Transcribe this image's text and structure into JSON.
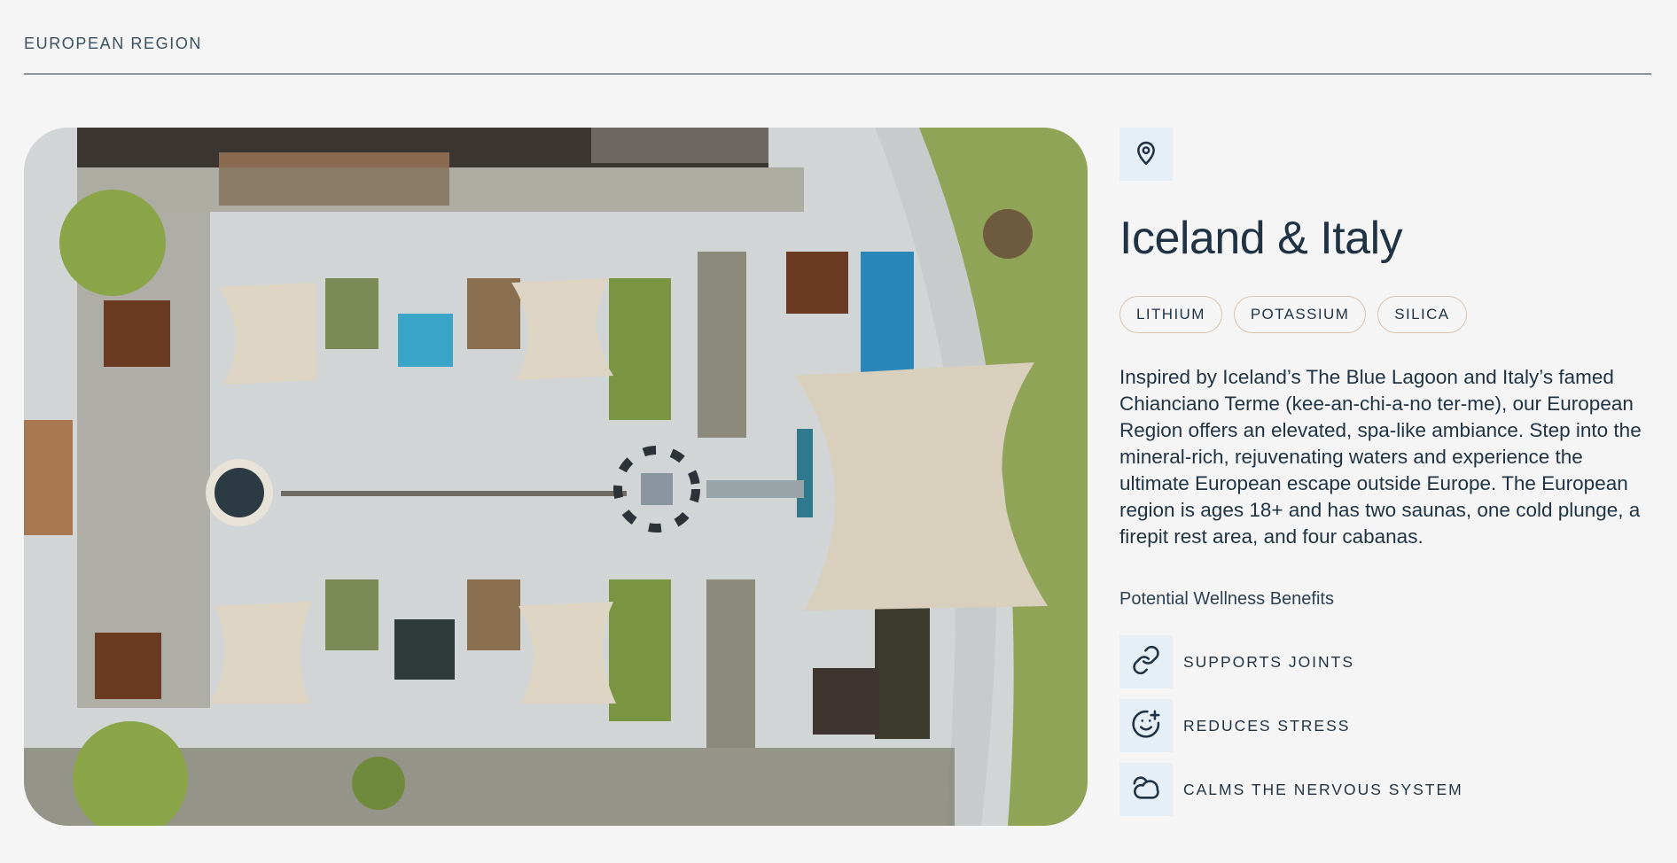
{
  "section": {
    "title": "EUROPEAN REGION"
  },
  "photo": {
    "alt": "Aerial view of the European region spa courtyard"
  },
  "location": {
    "icon": "map-pin-icon",
    "title": "Iceland & Italy"
  },
  "tags": [
    "LITHIUM",
    "POTASSIUM",
    "SILICA"
  ],
  "description": "Inspired by Iceland’s The Blue Lagoon and Italy’s famed Chianciano Terme (kee-an-chi-a-no ter-me), our European Region offers an elevated, spa-like ambiance. Step into the mineral-rich, rejuvenating waters and experience the ultimate European escape outside Europe. The European region is ages 18+ and has two saunas, one cold plunge, a firepit rest area, and four cabanas.",
  "benefits": {
    "title": "Potential Wellness Benefits",
    "items": [
      {
        "icon": "link-icon",
        "label": "SUPPORTS JOINTS"
      },
      {
        "icon": "smile-plus-icon",
        "label": "REDUCES STRESS"
      },
      {
        "icon": "cloud-icon",
        "label": "CALMS THE NERVOUS SYSTEM"
      }
    ]
  },
  "colors": {
    "background": "#f5f5f5",
    "text": "#1f3344",
    "icon_bg": "#e6eef6",
    "tag_border": "#d9c3ad"
  }
}
